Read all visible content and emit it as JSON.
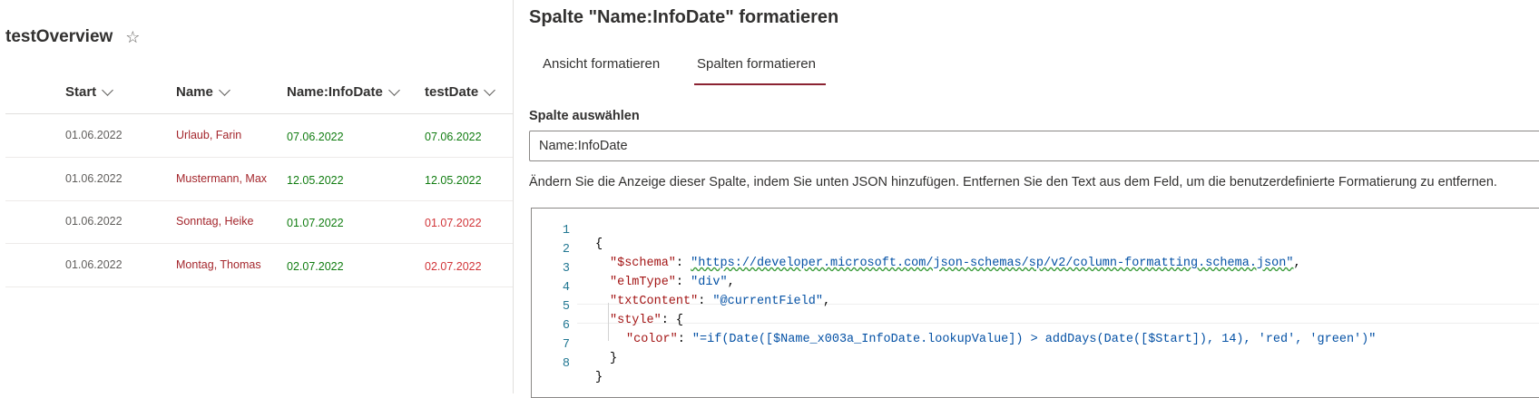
{
  "list": {
    "title": "testOverview",
    "favorite_icon": "star-icon",
    "columns": [
      "Start",
      "Name",
      "Name:InfoDate",
      "testDate"
    ],
    "rows": [
      {
        "start": "01.06.2022",
        "name": "Urlaub, Farin",
        "infodate": "07.06.2022",
        "testdate": "07.06.2022",
        "info_color": "green",
        "test_color": "green"
      },
      {
        "start": "01.06.2022",
        "name": "Mustermann, Max",
        "infodate": "12.05.2022",
        "testdate": "12.05.2022",
        "info_color": "green",
        "test_color": "green"
      },
      {
        "start": "01.06.2022",
        "name": "Sonntag, Heike",
        "infodate": "01.07.2022",
        "testdate": "01.07.2022",
        "info_color": "green",
        "test_color": "red"
      },
      {
        "start": "01.06.2022",
        "name": "Montag, Thomas",
        "infodate": "02.07.2022",
        "testdate": "02.07.2022",
        "info_color": "green",
        "test_color": "red"
      }
    ]
  },
  "panel": {
    "title": "Spalte \"Name:InfoDate\" formatieren",
    "tabs": [
      "Ansicht formatieren",
      "Spalten formatieren"
    ],
    "active_tab": "Spalten formatieren",
    "accent_color": "#8b2332",
    "select_label": "Spalte auswählen",
    "select_value": "Name:InfoDate",
    "hint": "Ändern Sie die Anzeige dieser Spalte, indem Sie unten JSON hinzufügen. Entfernen Sie den Text aus dem Feld, um die benutzerdefinierte Formatierung zu entfernen.",
    "code": {
      "line_numbers": [
        "1",
        "2",
        "3",
        "4",
        "5",
        "6",
        "7",
        "8"
      ],
      "brace_open": "{",
      "schema_key": "\"$schema\"",
      "schema_value": "\"https://developer.microsoft.com/json-schemas/sp/v2/column-formatting.schema.json\"",
      "elmtype_key": "\"elmType\"",
      "elmtype_value": "\"div\"",
      "txtcontent_key": "\"txtContent\"",
      "txtcontent_value": "\"@currentField\"",
      "style_key": "\"style\"",
      "color_key": "\"color\"",
      "color_value": "\"=if(Date([$Name_x003a_InfoDate.lookupValue]) > addDays(Date([$Start]), 14), 'red', 'green')\"",
      "inner_close": "}",
      "brace_close": "}"
    }
  }
}
